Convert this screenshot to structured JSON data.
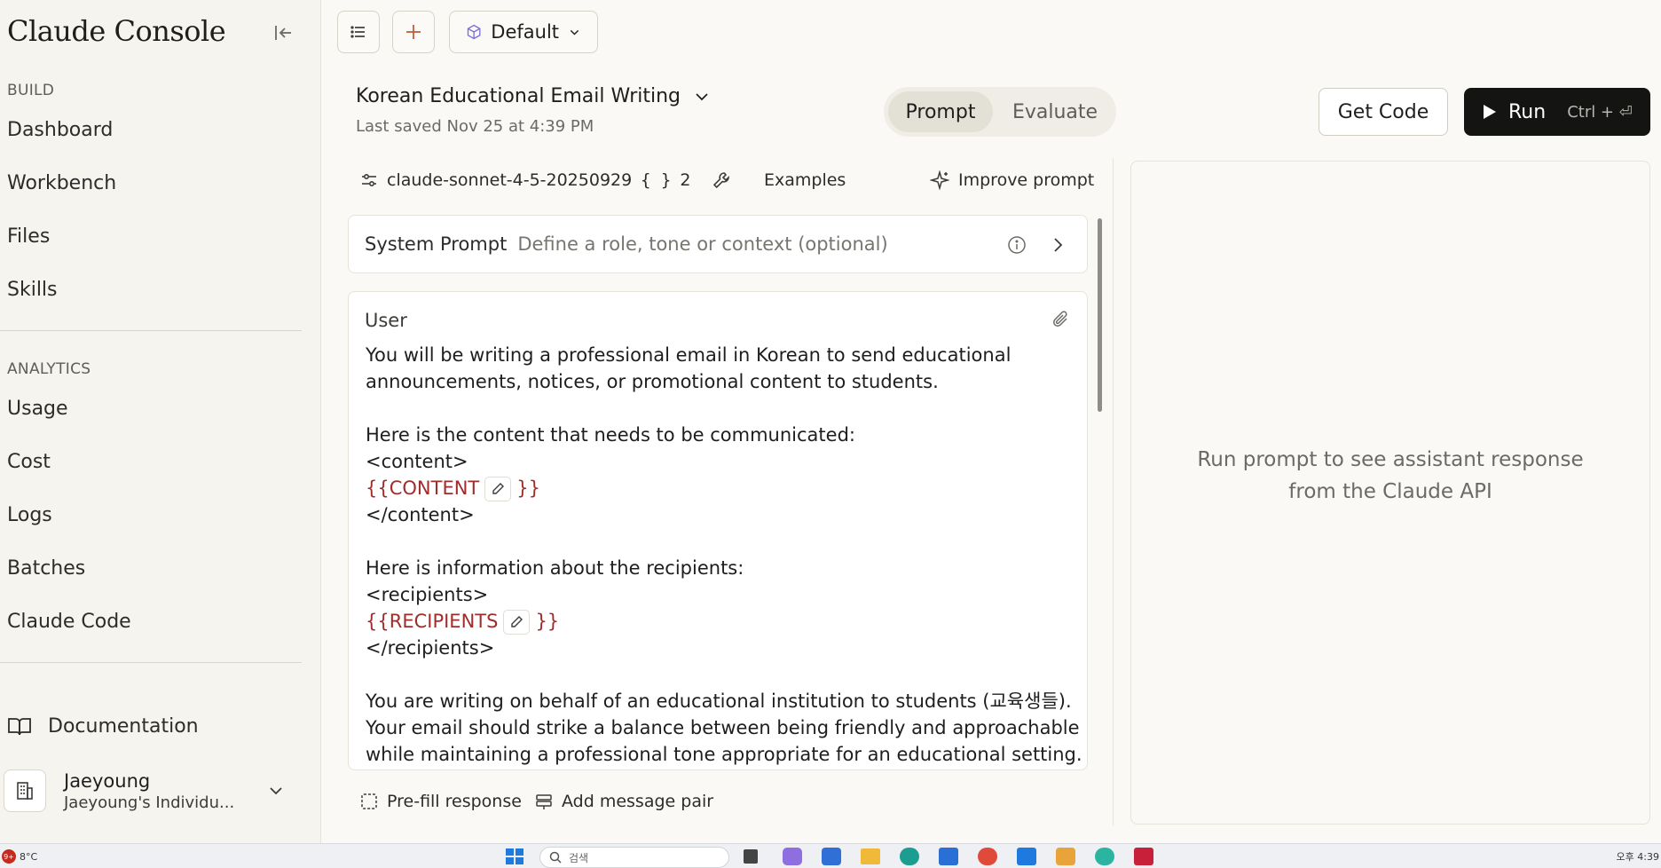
{
  "sidebar": {
    "brand": "Claude Console",
    "sections": [
      {
        "label": "BUILD",
        "items": [
          "Dashboard",
          "Workbench",
          "Files",
          "Skills"
        ]
      },
      {
        "label": "ANALYTICS",
        "items": [
          "Usage",
          "Cost",
          "Logs",
          "Batches",
          "Claude Code"
        ]
      }
    ],
    "documentation": "Documentation",
    "user": {
      "name": "Jaeyoung",
      "org": "Jaeyoung's Individu..."
    }
  },
  "toolbar": {
    "workspace": "Default"
  },
  "header": {
    "title": "Korean Educational Email Writing",
    "saved": "Last saved Nov 25 at 4:39 PM",
    "tabs": [
      {
        "label": "Prompt",
        "active": true
      },
      {
        "label": "Evaluate",
        "active": false
      }
    ],
    "get_code": "Get Code",
    "run": "Run",
    "run_shortcut": "Ctrl + ⏎"
  },
  "meta": {
    "model": "claude-sonnet-4-5-20250929",
    "variables_count": "2",
    "examples": "Examples",
    "improve": "Improve prompt"
  },
  "system_prompt": {
    "label": "System Prompt",
    "placeholder": "Define a role, tone or context (optional)"
  },
  "user_message": {
    "label": "User",
    "lines": [
      "You will be writing a professional email in Korean to send educational",
      "announcements, notices, or promotional content to students.",
      "",
      "Here is the content that needs to be communicated:",
      "<content>",
      "{{CONTENT}}",
      "</content>",
      "",
      "Here is information about the recipients:",
      "<recipients>",
      "{{RECIPIENTS}}",
      "</recipients>",
      "",
      "You are writing on behalf of an educational institution to students (교육생들).",
      "Your email should strike a balance between being friendly and approachable",
      "while maintaining a professional tone appropriate for an educational setting."
    ],
    "var_content_open": "{{CONTENT",
    "var_recipients_open": "{{RECIPIENTS",
    "var_close": "}}"
  },
  "actions": {
    "prefill": "Pre-fill response",
    "add_pair": "Add message pair"
  },
  "response": {
    "line1": "Run prompt to see assistant response",
    "line2": "from the Claude API"
  },
  "taskbar": {
    "temp": "8°C",
    "badge": "9+",
    "search": "검색",
    "time": "오후 4:39"
  }
}
